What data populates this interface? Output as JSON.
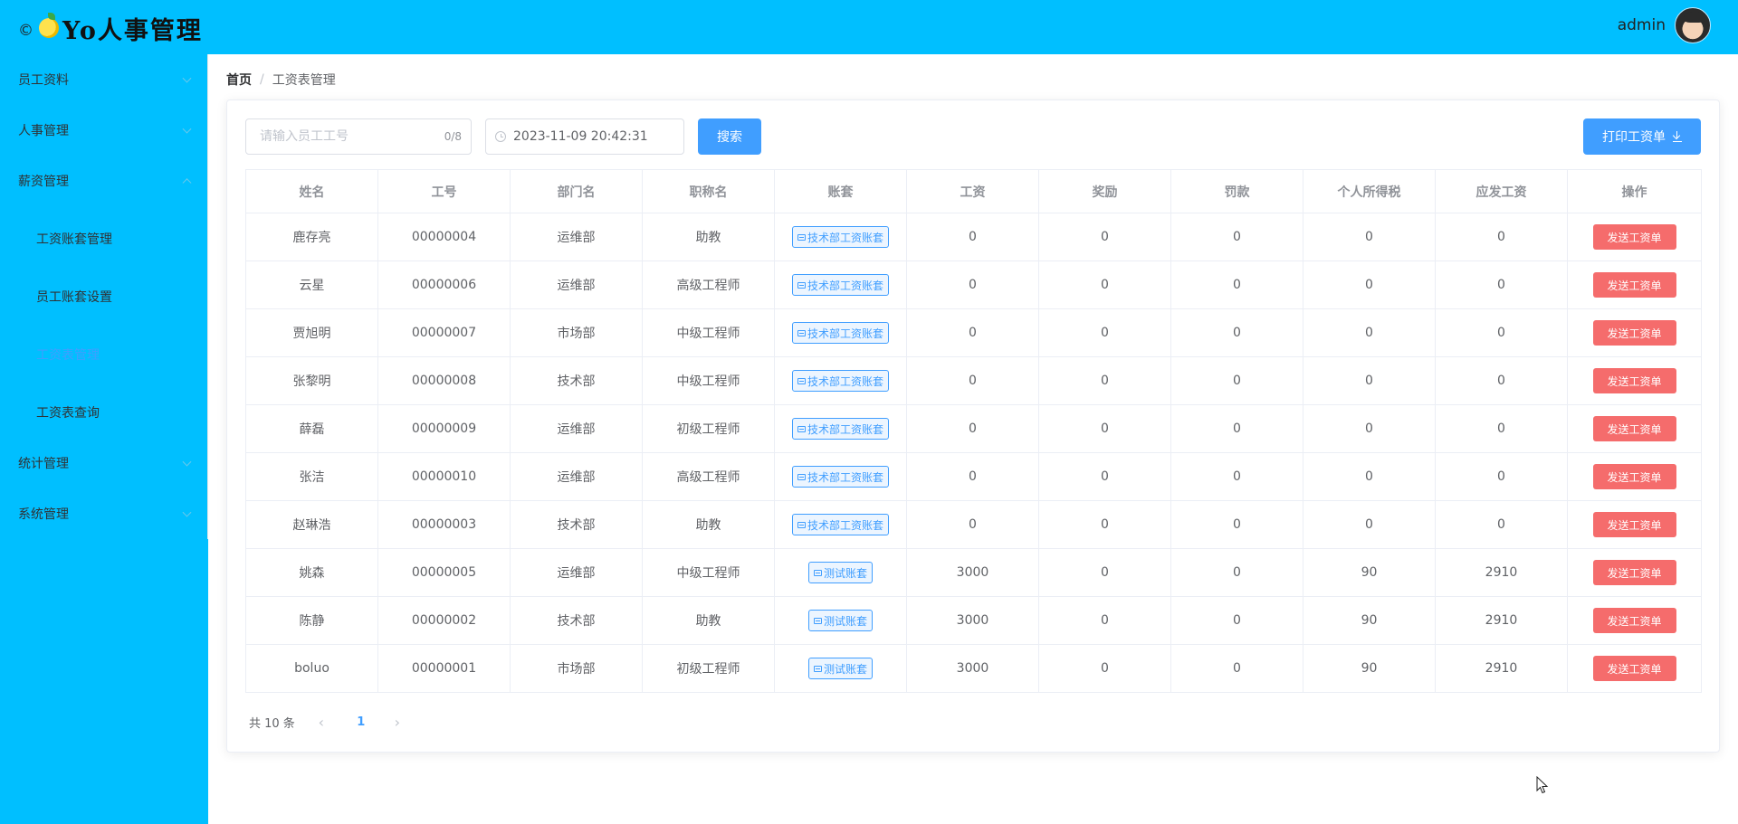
{
  "header": {
    "copyright": "©",
    "logo_text": "Yo人事管理",
    "username": "admin"
  },
  "sidebar": {
    "items": [
      {
        "label": "员工资料"
      },
      {
        "label": "人事管理"
      },
      {
        "label": "薪资管理"
      },
      {
        "label": "统计管理"
      },
      {
        "label": "系统管理"
      }
    ],
    "salary_children": [
      {
        "label": "工资账套管理"
      },
      {
        "label": "员工账套设置"
      },
      {
        "label": "工资表管理"
      },
      {
        "label": "工资表查询"
      }
    ]
  },
  "breadcrumb": {
    "home": "首页",
    "separator": "/",
    "current": "工资表管理"
  },
  "toolbar": {
    "search_placeholder": "请输入员工工号",
    "search_count": "0/8",
    "date_value": "2023-11-09 20:42:31",
    "search_label": "搜索",
    "print_label": "打印工资单"
  },
  "table": {
    "headers": [
      "姓名",
      "工号",
      "部门名",
      "职称名",
      "账套",
      "工资",
      "奖励",
      "罚款",
      "个人所得税",
      "应发工资",
      "操作"
    ],
    "action_label": "发送工资单",
    "rows": [
      {
        "name": "鹿存亮",
        "id": "00000004",
        "dept": "运维部",
        "title": "助教",
        "account": "技术部工资账套",
        "salary": "0",
        "bonus": "0",
        "fine": "0",
        "tax": "0",
        "net": "0"
      },
      {
        "name": "云星",
        "id": "00000006",
        "dept": "运维部",
        "title": "高级工程师",
        "account": "技术部工资账套",
        "salary": "0",
        "bonus": "0",
        "fine": "0",
        "tax": "0",
        "net": "0"
      },
      {
        "name": "贾旭明",
        "id": "00000007",
        "dept": "市场部",
        "title": "中级工程师",
        "account": "技术部工资账套",
        "salary": "0",
        "bonus": "0",
        "fine": "0",
        "tax": "0",
        "net": "0"
      },
      {
        "name": "张黎明",
        "id": "00000008",
        "dept": "技术部",
        "title": "中级工程师",
        "account": "技术部工资账套",
        "salary": "0",
        "bonus": "0",
        "fine": "0",
        "tax": "0",
        "net": "0"
      },
      {
        "name": "薛磊",
        "id": "00000009",
        "dept": "运维部",
        "title": "初级工程师",
        "account": "技术部工资账套",
        "salary": "0",
        "bonus": "0",
        "fine": "0",
        "tax": "0",
        "net": "0"
      },
      {
        "name": "张洁",
        "id": "00000010",
        "dept": "运维部",
        "title": "高级工程师",
        "account": "技术部工资账套",
        "salary": "0",
        "bonus": "0",
        "fine": "0",
        "tax": "0",
        "net": "0"
      },
      {
        "name": "赵琳浩",
        "id": "00000003",
        "dept": "技术部",
        "title": "助教",
        "account": "技术部工资账套",
        "salary": "0",
        "bonus": "0",
        "fine": "0",
        "tax": "0",
        "net": "0"
      },
      {
        "name": "姚森",
        "id": "00000005",
        "dept": "运维部",
        "title": "中级工程师",
        "account": "测试账套",
        "salary": "3000",
        "bonus": "0",
        "fine": "0",
        "tax": "90",
        "net": "2910"
      },
      {
        "name": "陈静",
        "id": "00000002",
        "dept": "技术部",
        "title": "助教",
        "account": "测试账套",
        "salary": "3000",
        "bonus": "0",
        "fine": "0",
        "tax": "90",
        "net": "2910"
      },
      {
        "name": "boluo",
        "id": "00000001",
        "dept": "市场部",
        "title": "初级工程师",
        "account": "测试账套",
        "salary": "3000",
        "bonus": "0",
        "fine": "0",
        "tax": "90",
        "net": "2910"
      }
    ]
  },
  "pager": {
    "total": "共 10 条",
    "current_page": "1"
  },
  "colors": {
    "brand": "#00bfff",
    "primary": "#409eff",
    "danger": "#f56c6c"
  }
}
